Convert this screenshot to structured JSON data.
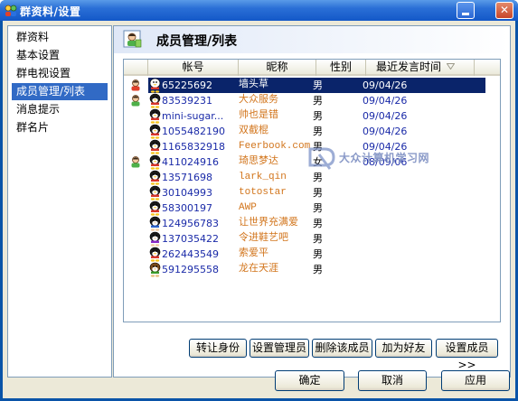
{
  "window": {
    "title": "群资料/设置"
  },
  "sidebar": {
    "items": [
      {
        "label": "群资料"
      },
      {
        "label": "基本设置"
      },
      {
        "label": "群电视设置"
      },
      {
        "label": "成员管理/列表",
        "selected": true
      },
      {
        "label": "消息提示"
      },
      {
        "label": "群名片"
      }
    ]
  },
  "panel": {
    "title": "成员管理/列表"
  },
  "member_list": {
    "columns": [
      "帐号",
      "昵称",
      "性别",
      "最近发言时间"
    ],
    "rows": [
      {
        "role": "owner",
        "avatar": "penguin-avatar-white",
        "account": "65225692",
        "nickname": "墙头草",
        "gender": "男",
        "last_speak": "09/04/26",
        "nick_color": "#ffffff",
        "selected": true
      },
      {
        "role": "admin",
        "avatar": "penguin-avatar",
        "account": "83539231",
        "nickname": "大众服务",
        "gender": "男",
        "last_speak": "09/04/26",
        "nick_color": "#d2751c"
      },
      {
        "role": "",
        "avatar": "penguin-avatar",
        "account": "mini-sugar...",
        "nickname": "帅也是错",
        "gender": "男",
        "last_speak": "09/04/26",
        "nick_color": "#d2751c"
      },
      {
        "role": "",
        "avatar": "penguin-avatar",
        "account": "1055482190",
        "nickname": "双截棍",
        "gender": "男",
        "last_speak": "09/04/26",
        "nick_color": "#d2751c"
      },
      {
        "role": "",
        "avatar": "penguin-avatar",
        "account": "1165832918",
        "nickname": "Feerbook.com",
        "gender": "男",
        "last_speak": "09/04/26",
        "nick_color": "#d2751c"
      },
      {
        "role": "admin",
        "avatar": "penguin-avatar-girl",
        "account": "411024916",
        "nickname": "琦思梦达",
        "gender": "女",
        "last_speak": "08/09/06",
        "nick_color": "#d2751c"
      },
      {
        "role": "",
        "avatar": "penguin-avatar",
        "account": "13571698",
        "nickname": "lark_qin",
        "gender": "男",
        "last_speak": "",
        "nick_color": "#d2751c"
      },
      {
        "role": "",
        "avatar": "penguin-avatar",
        "account": "30104993",
        "nickname": "totostar",
        "gender": "男",
        "last_speak": "",
        "nick_color": "#d2751c"
      },
      {
        "role": "",
        "avatar": "penguin-avatar",
        "account": "58300197",
        "nickname": "AWP",
        "gender": "男",
        "last_speak": "",
        "nick_color": "#d2751c"
      },
      {
        "role": "",
        "avatar": "cartoon-avatar-blue",
        "account": "124956783",
        "nickname": "让世界充满爱",
        "gender": "男",
        "last_speak": "",
        "nick_color": "#d2751c"
      },
      {
        "role": "",
        "avatar": "cartoon-avatar-purple",
        "account": "137035422",
        "nickname": "令进鞋艺吧",
        "gender": "男",
        "last_speak": "",
        "nick_color": "#d2751c"
      },
      {
        "role": "",
        "avatar": "penguin-avatar",
        "account": "262443549",
        "nickname": "索爱平",
        "gender": "男",
        "last_speak": "",
        "nick_color": "#d2751c"
      },
      {
        "role": "",
        "avatar": "dog-avatar-green",
        "account": "591295558",
        "nickname": "龙在天涯",
        "gender": "男",
        "last_speak": "",
        "nick_color": "#d2751c"
      }
    ]
  },
  "watermark": {
    "text": "大众计算机学习网"
  },
  "actions": {
    "transfer": "转让身份",
    "set_admin": "设置管理员",
    "delete_member": "删除该成员",
    "add_friend": "加为好友",
    "set_member": "设置成员>>"
  },
  "footer": {
    "ok": "确定",
    "cancel": "取消",
    "apply": "应用"
  },
  "colors": {
    "title_bar": "#2a6fd6",
    "selection": "#0a246a",
    "nickname": "#d2751c",
    "account": "#1a2aa8"
  }
}
